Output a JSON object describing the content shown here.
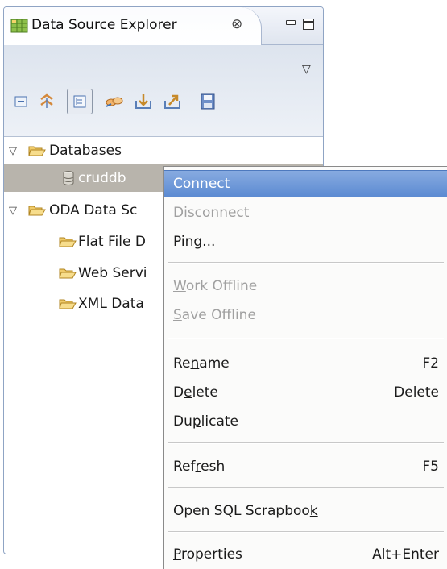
{
  "view": {
    "title": "Data Source Explorer",
    "close_glyph": "⊗",
    "view_menu_glyph": "▽",
    "toolbar_buttons": [
      {
        "icon": "collapse-all-icon"
      },
      {
        "icon": "link-with-editor-icon"
      },
      {
        "icon": "show-hierarchy-icon",
        "pressed": true
      },
      {
        "icon": "connect-profile-icon"
      },
      {
        "icon": "import-profiles-icon"
      },
      {
        "icon": "export-profiles-icon"
      },
      {
        "icon": "save-icon"
      }
    ]
  },
  "tree": {
    "expand_glyph": "▽",
    "items": [
      {
        "label": "Databases",
        "level": 0,
        "expanded": true
      },
      {
        "label": "cruddb",
        "level": 1,
        "selected": true
      },
      {
        "label": "ODA Data Sc",
        "level": 0,
        "expanded": true
      },
      {
        "label": "Flat File D",
        "level": 1
      },
      {
        "label": "Web Servi",
        "level": 1
      },
      {
        "label": "XML Data",
        "level": 1
      }
    ]
  },
  "context_menu": {
    "items": [
      {
        "pre": "",
        "mn": "C",
        "post": "onnect",
        "accel": "",
        "state": "hover"
      },
      {
        "pre": "",
        "mn": "D",
        "post": "isconnect",
        "accel": "",
        "state": "disabled"
      },
      {
        "pre": "",
        "mn": "P",
        "post": "ing...",
        "accel": "",
        "state": "normal"
      },
      {
        "pre": "",
        "mn": "W",
        "post": "ork Offline",
        "accel": "",
        "state": "disabled"
      },
      {
        "pre": "",
        "mn": "S",
        "post": "ave Offline",
        "accel": "",
        "state": "disabled"
      },
      {
        "pre": "Re",
        "mn": "n",
        "post": "ame",
        "accel": "F2",
        "state": "normal"
      },
      {
        "pre": "D",
        "mn": "e",
        "post": "lete",
        "accel": "Delete",
        "state": "normal"
      },
      {
        "pre": "Du",
        "mn": "p",
        "post": "licate",
        "accel": "",
        "state": "normal"
      },
      {
        "pre": "Ref",
        "mn": "r",
        "post": "esh",
        "accel": "F5",
        "state": "normal"
      },
      {
        "pre": "Open SQL Scrapboo",
        "mn": "k",
        "post": "",
        "accel": "",
        "state": "normal"
      },
      {
        "pre": "",
        "mn": "P",
        "post": "roperties",
        "accel": "Alt+Enter",
        "state": "normal"
      }
    ]
  },
  "colors": {
    "selection": "#b8b4ac",
    "menu_highlight": "#6f98d8",
    "view_border": "#8fa4c4",
    "folder": "#e8b84a"
  }
}
